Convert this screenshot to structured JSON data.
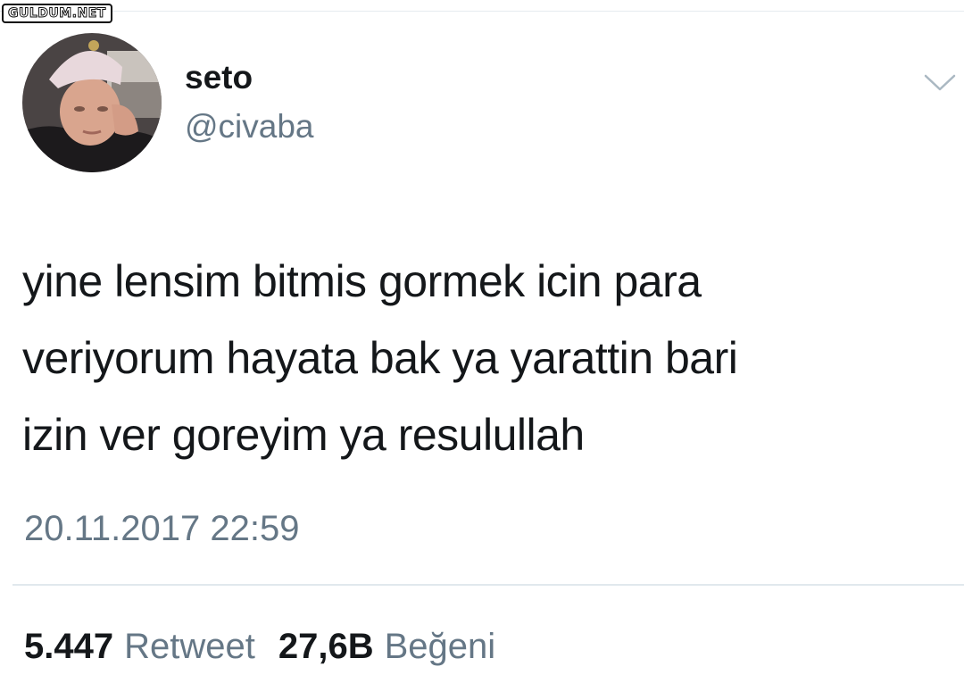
{
  "watermark": {
    "text": "GULDUM.NET"
  },
  "user": {
    "display_name": "seto",
    "handle": "@civaba"
  },
  "tweet": {
    "text": "yine lensim bitmis gormek icin para\nveriyorum hayata bak ya yarattin bari\nizin ver goreyim ya resulullah",
    "timestamp": "20.11.2017 22:59"
  },
  "stats": {
    "retweet_count": "5.447",
    "retweet_label": "Retweet",
    "like_count": "27,6B",
    "like_label": "Beğeni"
  },
  "icons": {
    "menu": "chevron-down-icon"
  },
  "colors": {
    "text_primary": "#14171a",
    "text_secondary": "#657786",
    "divider": "#e1e8ed"
  }
}
